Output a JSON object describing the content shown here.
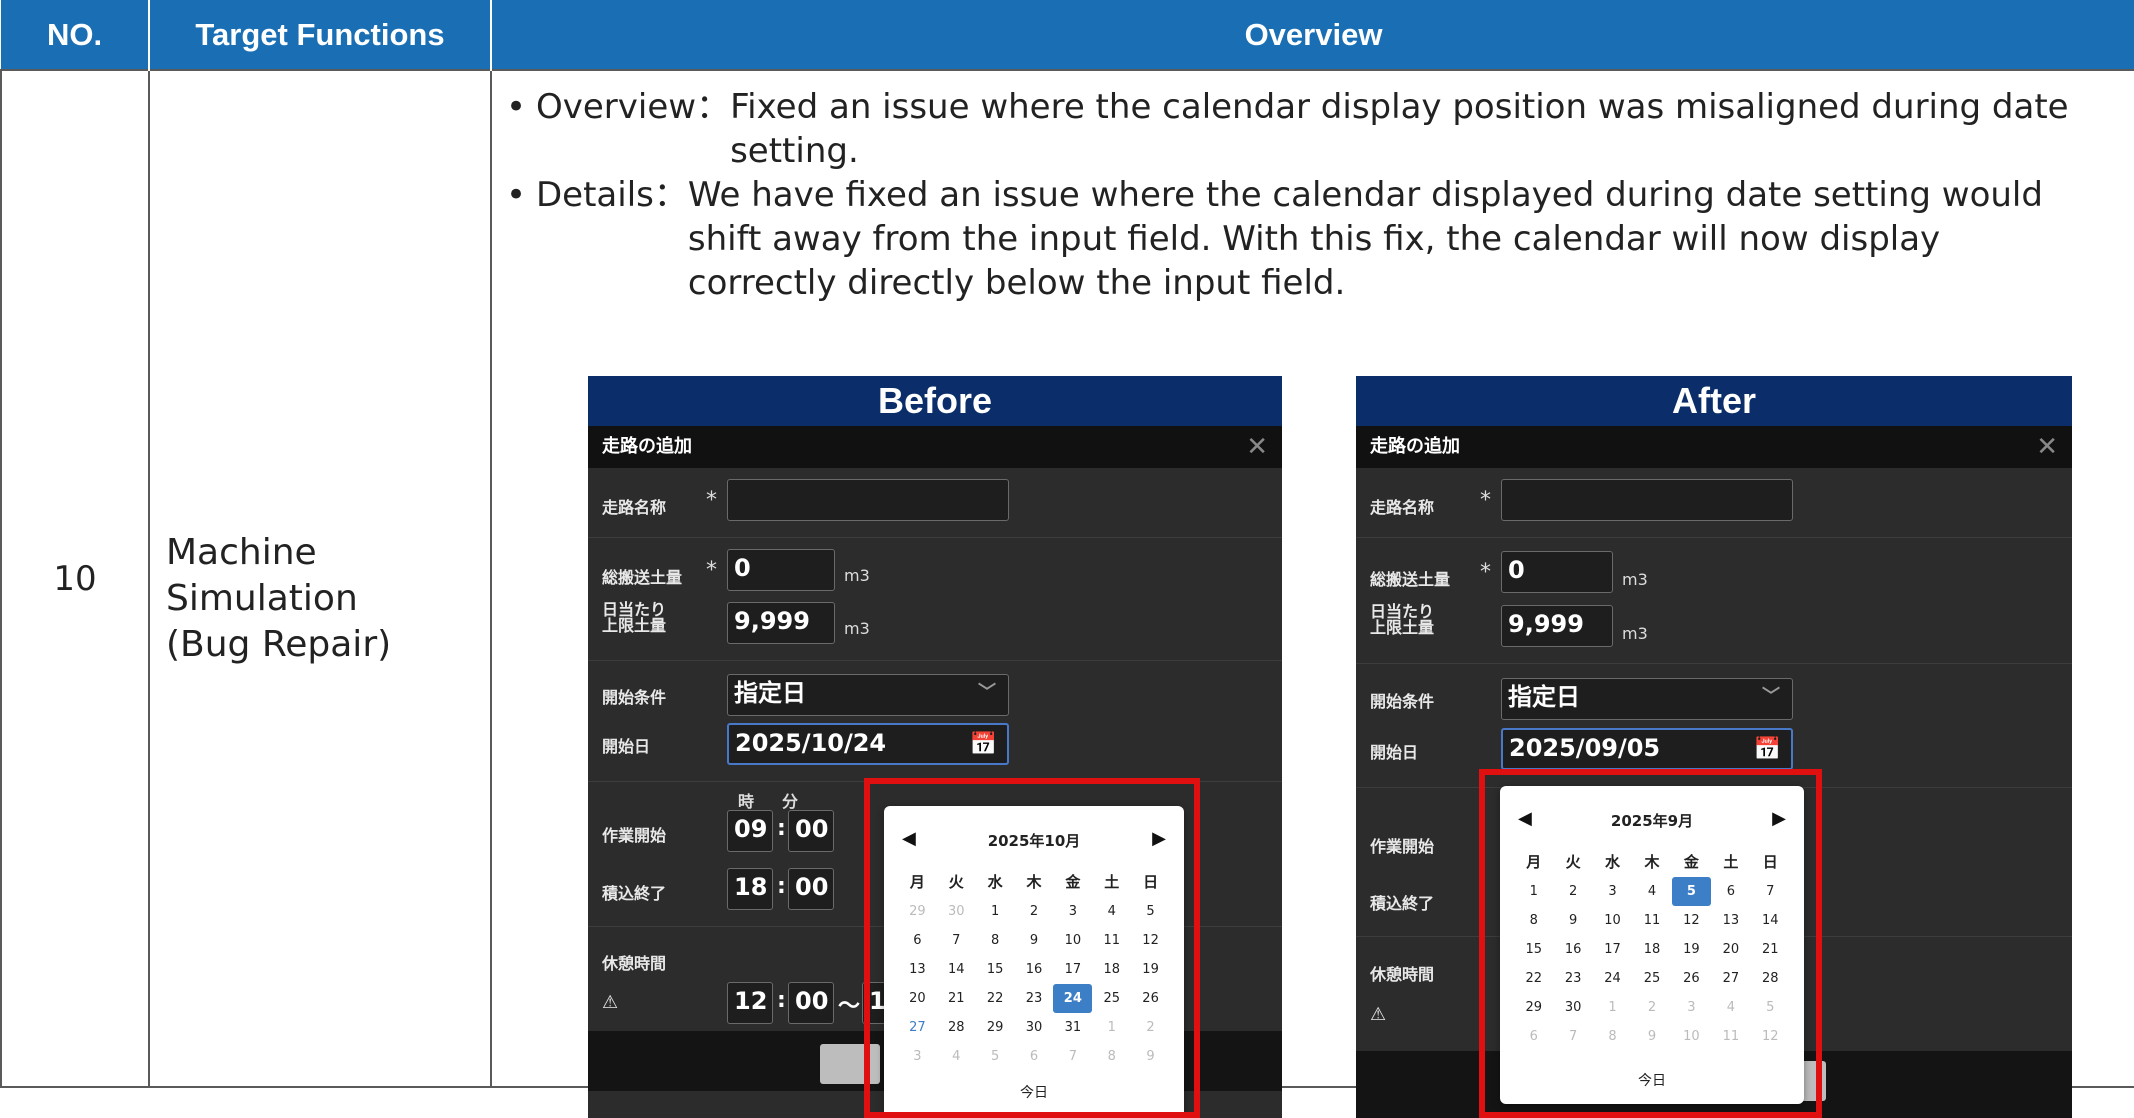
{
  "header": {
    "no": "NO.",
    "functions": "Target Functions",
    "overview": "Overview"
  },
  "row": {
    "no": "10",
    "function_lines": [
      "Machine",
      "Simulation",
      "(Bug Repair)"
    ],
    "bullets": [
      {
        "label": "Overview：",
        "lines": [
          "Fixed an issue where the calendar display position was misaligned during date",
          "setting."
        ]
      },
      {
        "label": "Details：",
        "lines": [
          "We have fixed an issue where the calendar displayed during date setting would",
          "shift away from the input field. With this fix, the calendar will now display",
          "correctly directly below the input field."
        ]
      }
    ]
  },
  "panels": {
    "before": {
      "title": "Before",
      "dialog_title": "走路の追加",
      "close": "✕",
      "name_label": "走路名称",
      "total_label": "総搬送土量",
      "total_value": "0",
      "unit": "m3",
      "daily_label_1": "日当たり",
      "daily_label_2": "上限土量",
      "daily_value": "9,999",
      "start_cond_label": "開始条件",
      "start_cond_value": "指定日",
      "start_date_label": "開始日",
      "start_date_value": "2025/10/24",
      "hour_label": "時",
      "min_label": "分",
      "work_start_label": "作業開始",
      "work_start_h": "09",
      "work_start_m": "00",
      "load_end_label": "積込終了",
      "load_end_h": "18",
      "load_end_m": "00",
      "rest_label": "休憩時間",
      "rest_h": "12",
      "rest_m": "00",
      "tilde": "～",
      "rest_cut": "1",
      "warning": "⚠",
      "calendar": {
        "title": "2025年10月",
        "prev": "◀",
        "next": "▶",
        "weekdays": [
          "月",
          "火",
          "水",
          "木",
          "金",
          "土",
          "日"
        ],
        "days": [
          [
            "29",
            "30",
            "1",
            "2",
            "3",
            "4",
            "5"
          ],
          [
            "6",
            "7",
            "8",
            "9",
            "10",
            "11",
            "12"
          ],
          [
            "13",
            "14",
            "15",
            "16",
            "17",
            "18",
            "19"
          ],
          [
            "20",
            "21",
            "22",
            "23",
            "24",
            "25",
            "26"
          ],
          [
            "27",
            "28",
            "29",
            "30",
            "31",
            "1",
            "2"
          ],
          [
            "3",
            "4",
            "5",
            "6",
            "7",
            "8",
            "9"
          ]
        ],
        "selected": "24",
        "today_label": "今日"
      }
    },
    "after": {
      "title": "After",
      "dialog_title": "走路の追加",
      "close": "✕",
      "name_label": "走路名称",
      "total_label": "総搬送土量",
      "total_value": "0",
      "unit": "m3",
      "daily_label_1": "日当たり",
      "daily_label_2": "上限土量",
      "daily_value": "9,999",
      "start_cond_label": "開始条件",
      "start_cond_value": "指定日",
      "start_date_label": "開始日",
      "start_date_value": "2025/09/05",
      "work_start_label": "作業開始",
      "load_end_label": "積込終了",
      "rest_label": "休憩時間",
      "warning": "⚠",
      "calendar": {
        "title": "2025年9月",
        "prev": "◀",
        "next": "▶",
        "weekdays": [
          "月",
          "火",
          "水",
          "木",
          "金",
          "土",
          "日"
        ],
        "days": [
          [
            "1",
            "2",
            "3",
            "4",
            "5",
            "6",
            "7"
          ],
          [
            "8",
            "9",
            "10",
            "11",
            "12",
            "13",
            "14"
          ],
          [
            "15",
            "16",
            "17",
            "18",
            "19",
            "20",
            "21"
          ],
          [
            "22",
            "23",
            "24",
            "25",
            "26",
            "27",
            "28"
          ],
          [
            "29",
            "30",
            "1",
            "2",
            "3",
            "4",
            "5"
          ],
          [
            "6",
            "7",
            "8",
            "9",
            "10",
            "11",
            "12"
          ]
        ],
        "selected": "5",
        "today_label": "今日"
      }
    }
  },
  "colors": {
    "header_bg": "#1a6fb4",
    "panel_title_bg": "#0b2e6b",
    "highlight": "#e01010",
    "selected_day": "#3d7fc7"
  }
}
